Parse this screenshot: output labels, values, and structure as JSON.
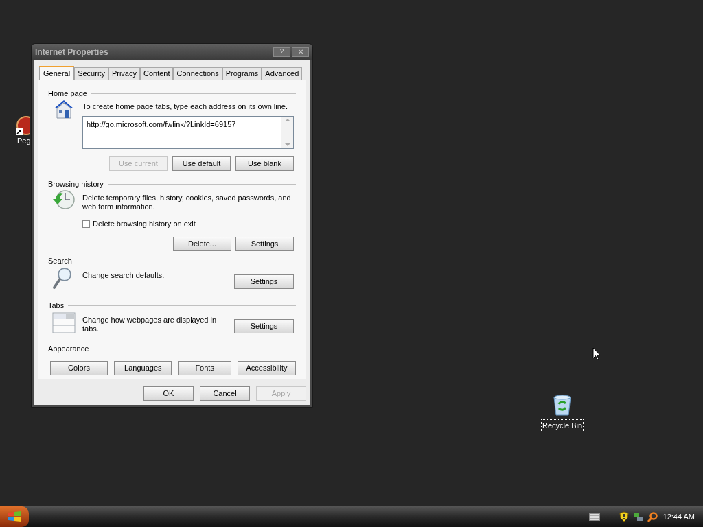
{
  "desktop_icons": [
    {
      "kind": "ball",
      "label": "Peg",
      "selected": false
    },
    {
      "kind": "bin",
      "label": "Recycle Bin",
      "selected": true
    }
  ],
  "window": {
    "title": "Internet Properties",
    "title_buttons": [
      "?",
      "✕"
    ]
  },
  "tabs": [
    {
      "label": "General",
      "selected": true
    },
    {
      "label": "Security",
      "selected": false
    },
    {
      "label": "Privacy",
      "selected": false
    },
    {
      "label": "Content",
      "selected": false
    },
    {
      "label": "Connections",
      "selected": false
    },
    {
      "label": "Programs",
      "selected": false
    },
    {
      "label": "Advanced",
      "selected": false
    }
  ],
  "sections": [
    {
      "kind": "home",
      "title": "Home page",
      "description": "To create home page tabs, type each address on its own line.",
      "value": "http://go.microsoft.com/fwlink/?LinkId=69157",
      "buttons": [
        {
          "label": "Use current",
          "disabled": true
        },
        {
          "label": "Use default",
          "disabled": false
        },
        {
          "label": "Use blank",
          "disabled": false
        }
      ]
    },
    {
      "kind": "history",
      "title": "Browsing history",
      "description": "Delete temporary files, history, cookies, saved passwords, and web form information.",
      "checkbox": {
        "label": "Delete browsing history on exit",
        "checked": false
      },
      "buttons": [
        {
          "label": "Delete...",
          "disabled": false
        },
        {
          "label": "Settings",
          "disabled": false
        }
      ]
    },
    {
      "kind": "search",
      "title": "Search",
      "description": "Change search defaults.",
      "buttons": [
        {
          "label": "Settings",
          "disabled": false
        }
      ]
    },
    {
      "kind": "tabs",
      "title": "Tabs",
      "description": "Change how webpages are displayed in tabs.",
      "buttons": [
        {
          "label": "Settings",
          "disabled": false
        }
      ]
    },
    {
      "kind": "appearance",
      "title": "Appearance",
      "buttons": [
        {
          "label": "Colors",
          "disabled": false
        },
        {
          "label": "Languages",
          "disabled": false
        },
        {
          "label": "Fonts",
          "disabled": false
        },
        {
          "label": "Accessibility",
          "disabled": false
        }
      ]
    }
  ],
  "dialog_buttons": [
    {
      "label": "OK",
      "disabled": false
    },
    {
      "label": "Cancel",
      "disabled": false
    },
    {
      "label": "Apply",
      "disabled": true
    }
  ],
  "taskbar": {
    "clock": "12:44 AM"
  }
}
